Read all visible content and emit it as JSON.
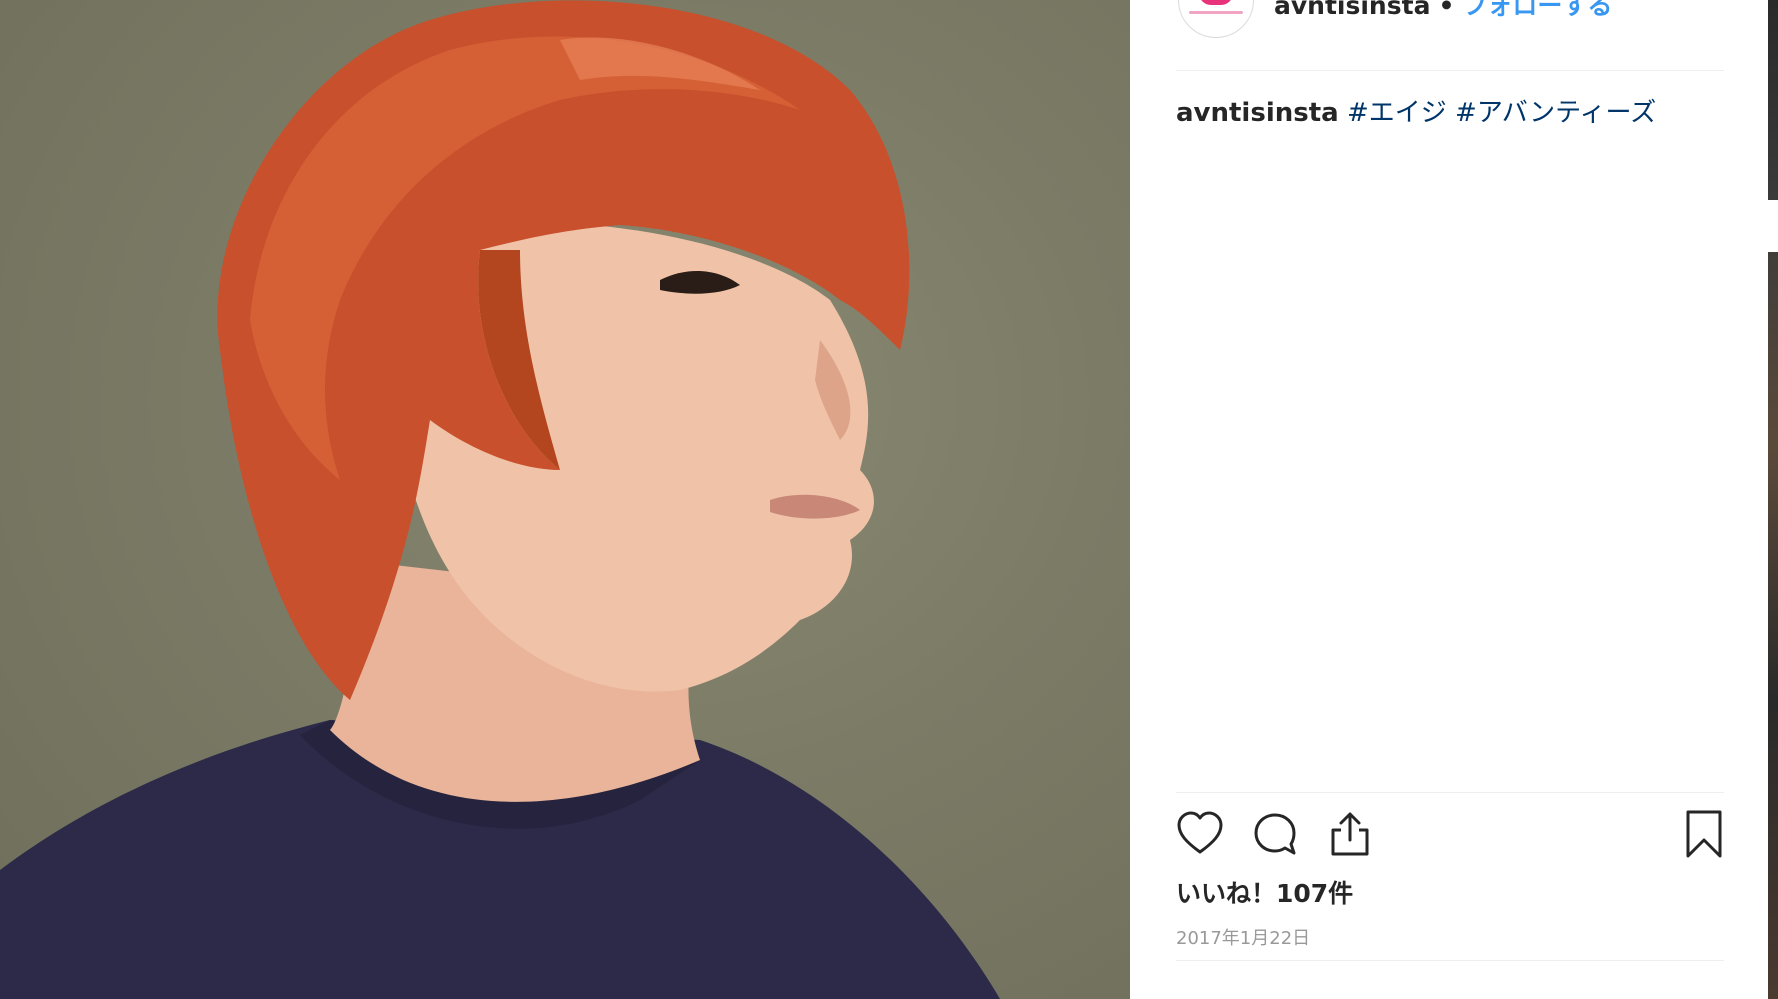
{
  "photo": {
    "icon": "portrait-photo"
  },
  "post_header": {
    "username": "avntisinsta",
    "separator": "•",
    "follow_label": "フォローする"
  },
  "caption": {
    "username": "avntisinsta",
    "hashtags": [
      "#エイジ",
      "#アバンティーズ"
    ]
  },
  "actions": {
    "like_icon": "heart-icon",
    "comment_icon": "comment-icon",
    "share_icon": "share-icon",
    "save_icon": "bookmark-icon"
  },
  "likes_text": "いいね！107件",
  "date": "2017年1月22日",
  "colors": {
    "link_blue": "#3897f0",
    "hashtag": "#003569",
    "text": "#262626",
    "muted": "#999999",
    "brand_pink": "#e8337a"
  }
}
